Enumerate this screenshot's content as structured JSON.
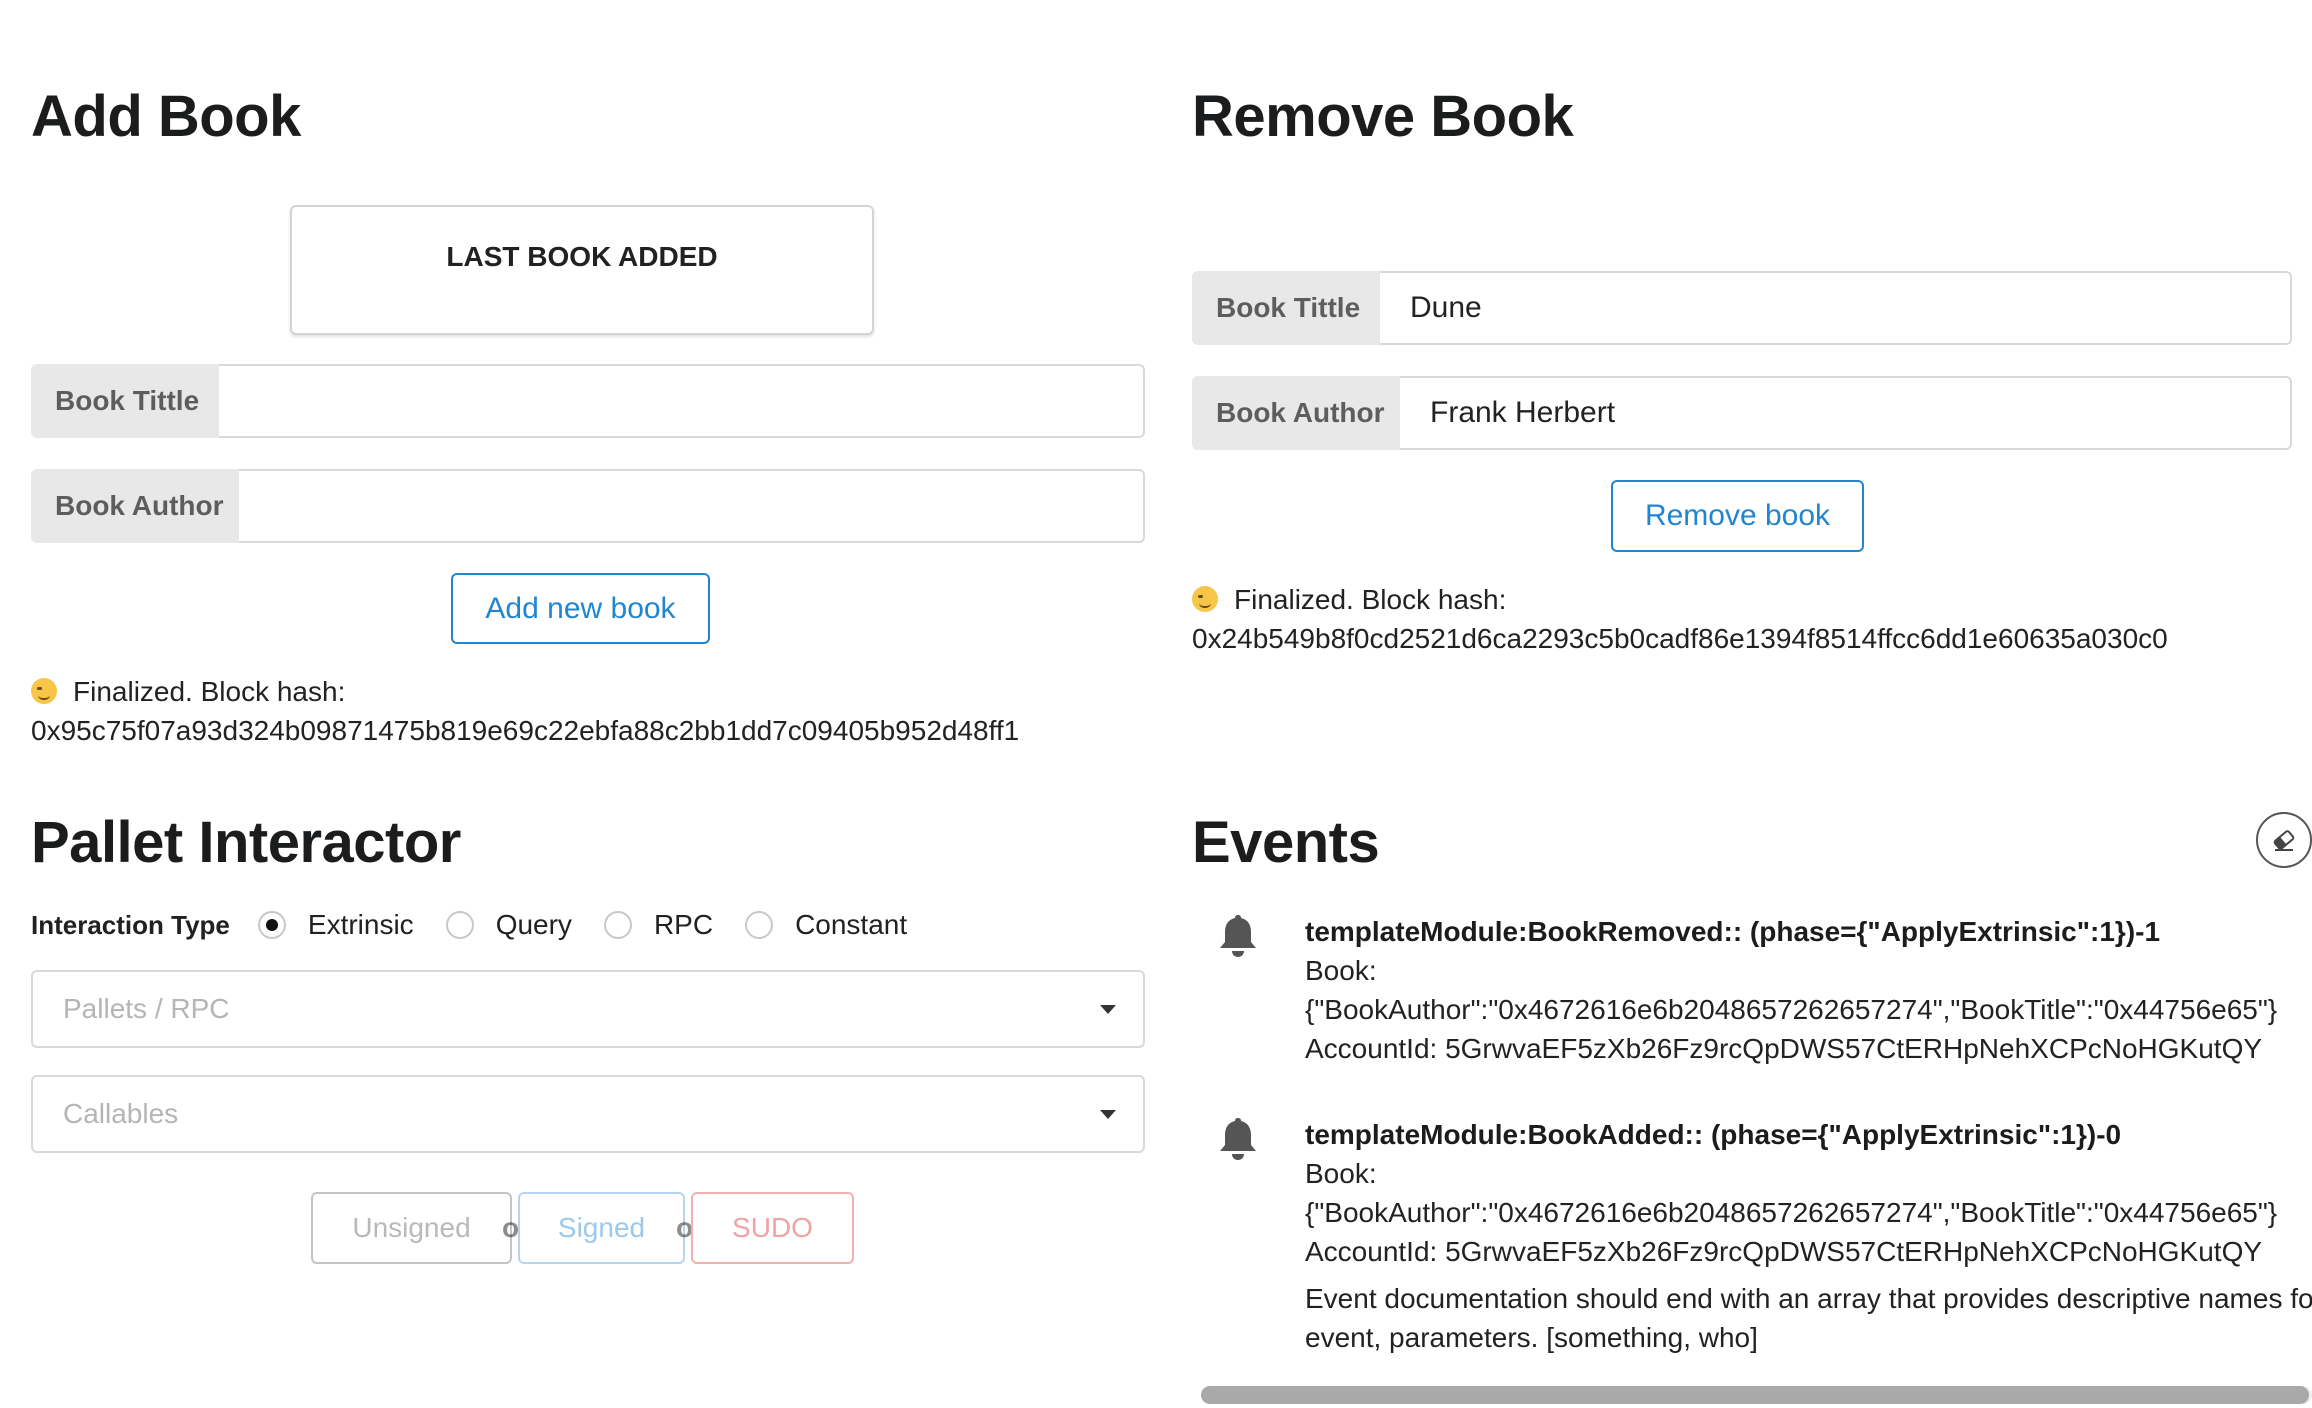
{
  "add_book": {
    "heading": "Add Book",
    "last_book_card_title": "LAST BOOK ADDED",
    "title_label": "Book Tittle",
    "title_value": "",
    "author_label": "Book Author",
    "author_value": "",
    "button_label": "Add new book",
    "status_prefix": "Finalized. Block hash:",
    "status_hash": "0x95c75f07a93d324b09871475b819e69c22ebfa88c2bb1dd7c09405b952d48ff1"
  },
  "remove_book": {
    "heading": "Remove Book",
    "title_label": "Book Tittle",
    "title_value": "Dune",
    "author_label": "Book Author",
    "author_value": "Frank Herbert",
    "button_label": "Remove book",
    "status_prefix": "Finalized. Block hash:",
    "status_hash": "0x24b549b8f0cd2521d6ca2293c5b0cadf86e1394f8514ffcc6dd1e60635a030c0"
  },
  "pallet": {
    "heading": "Pallet Interactor",
    "interaction_type_label": "Interaction Type",
    "options": [
      "Extrinsic",
      "Query",
      "RPC",
      "Constant"
    ],
    "selected_option": "Extrinsic",
    "pallets_placeholder": "Pallets / RPC",
    "callables_placeholder": "Callables",
    "unsigned_label": "Unsigned",
    "or_label": "or",
    "signed_label": "Signed",
    "sudo_label": "SUDO"
  },
  "events": {
    "heading": "Events",
    "items": [
      {
        "title": "templateModule:BookRemoved:: (phase={\"ApplyExtrinsic\":1})-1",
        "line1": "Book:",
        "line2": "{\"BookAuthor\":\"0x4672616e6b2048657262657274\",\"BookTitle\":\"0x44756e65\"}",
        "line3": "AccountId: 5GrwvaEF5zXb26Fz9rcQpDWS57CtERHpNehXCPcNoHGKutQY",
        "doc": ""
      },
      {
        "title": "templateModule:BookAdded:: (phase={\"ApplyExtrinsic\":1})-0",
        "line1": "Book:",
        "line2": "{\"BookAuthor\":\"0x4672616e6b2048657262657274\",\"BookTitle\":\"0x44756e65\"}",
        "line3": "AccountId: 5GrwvaEF5zXb26Fz9rcQpDWS57CtERHpNehXCPcNoHGKutQY",
        "doc": "Event documentation should end with an array that provides descriptive names for event, parameters. [something, who]"
      }
    ]
  },
  "icons": {
    "status_emoji": "winking-face-icon",
    "event_icon": "bell-icon",
    "clear_events": "eraser-icon"
  },
  "colors": {
    "primary": "#2185d0",
    "signed": "#9cc8ec",
    "sudo": "#f1a3a3",
    "label_bg": "#e8e8e8"
  }
}
